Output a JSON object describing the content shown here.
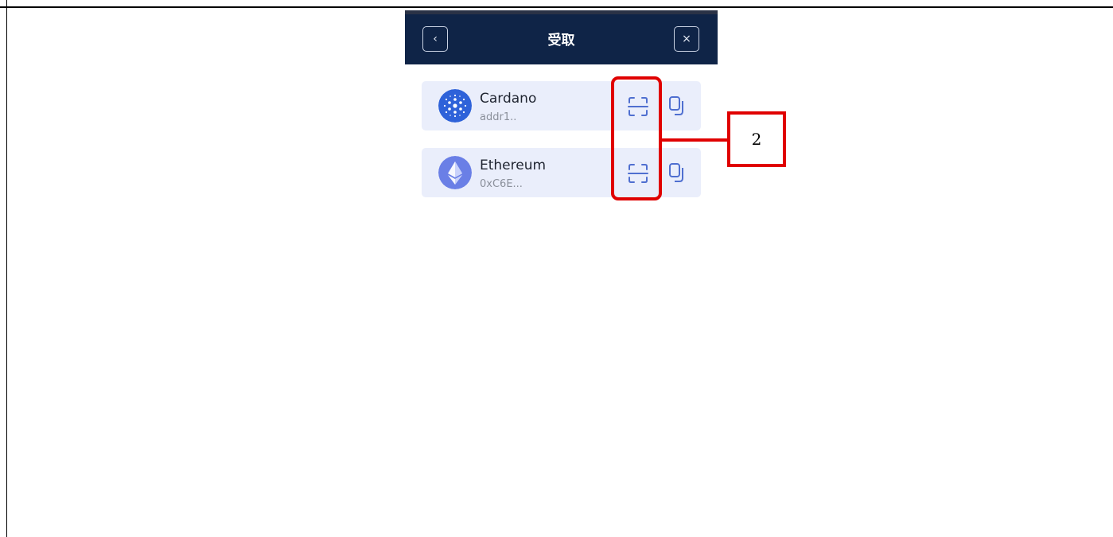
{
  "header": {
    "title": "受取",
    "back_icon": "chevron-left-icon",
    "close_icon": "close-icon",
    "back_glyph": "‹",
    "close_glyph": "×"
  },
  "wallets": [
    {
      "name": "Cardano",
      "address": "addr1..",
      "logo_icon": "cardano-logo-icon",
      "logo_color": "#2e62d9"
    },
    {
      "name": "Ethereum",
      "address": "0xC6E...",
      "logo_icon": "ethereum-logo-icon",
      "logo_color": "#6a7fe6"
    }
  ],
  "actions": {
    "qr_icon": "scan-qr-icon",
    "copy_icon": "copy-icon",
    "icon_color": "#4f6fd0"
  },
  "annotation": {
    "label": "2",
    "color": "#e00000"
  },
  "colors": {
    "header_bg": "#0f2447",
    "card_bg": "#eaeefb"
  }
}
